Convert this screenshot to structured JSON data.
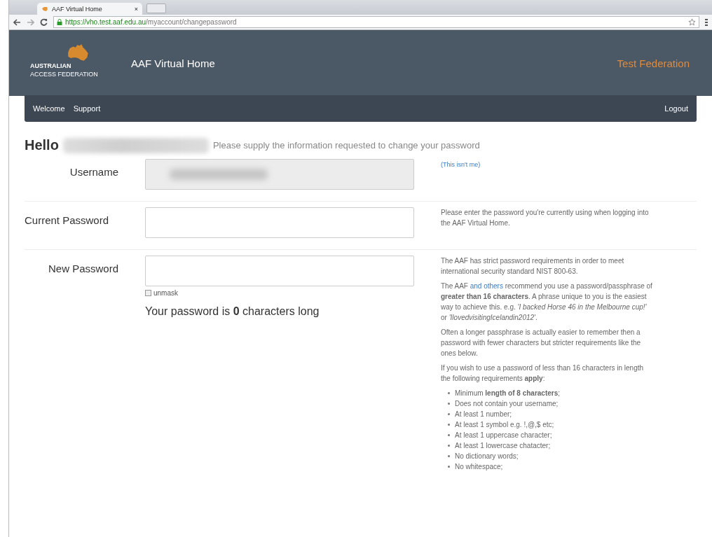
{
  "browser": {
    "tab_title": "AAF Virtual Home",
    "tab_close": "×",
    "url_host": "https://vho.test.aaf.edu.au",
    "url_path": "/myaccount/changepassword"
  },
  "header": {
    "logo_line1": "AUSTRALIAN",
    "logo_line2": "ACCESS FEDERATION",
    "title": "AAF Virtual Home",
    "federation": "Test Federation"
  },
  "nav": {
    "items": [
      "Welcome",
      "Support"
    ],
    "logout": "Logout"
  },
  "greeting": {
    "hello": "Hello",
    "subtitle": "Please supply the information requested to change your password"
  },
  "rows": [
    {
      "kind": "readonly",
      "label": "Username",
      "help": [
        {
          "kind": "link",
          "text": "(This isn't me)"
        }
      ]
    },
    {
      "kind": "password",
      "label": "Current Password",
      "help": [
        {
          "kind": "para",
          "parts": [
            {
              "text": "Please enter the password you're currently using when logging into the AAF Virtual Home."
            }
          ]
        }
      ]
    },
    {
      "kind": "newpassword",
      "label": "New Password",
      "unmask": {
        "label": "unmask",
        "checked": false
      },
      "length_text": "Your password is **0** characters long",
      "help": [
        {
          "kind": "para",
          "parts": [
            {
              "text": "The AAF has strict password requirements in order to meet international security standard NIST 800-63."
            }
          ]
        },
        {
          "kind": "para",
          "parts": [
            {
              "text": "The AAF "
            },
            {
              "link": "and others"
            },
            {
              "text": " recommend you use a password/passphrase of **greater than 16 characters**. A phrase unique to you is the easiest way to achieve this. e.g. *'I backed Horse 46 in the Melbourne cup!'* or *'IlovedvisitingIcelandin2012'*."
            }
          ]
        },
        {
          "kind": "para",
          "parts": [
            {
              "text": "Often a longer passphrase is actually easier to remember then a password with fewer characters but stricter requirements like the ones below."
            }
          ]
        },
        {
          "kind": "para",
          "parts": [
            {
              "text": "If you wish to use a password of less than 16 characters in length the following requirements **apply**:"
            }
          ]
        },
        {
          "kind": "list",
          "items": [
            "Minimum **length of 8 characters**;",
            "Does not contain your username;",
            "At least 1 number;",
            "At least 1 symbol e.g. !,@,$ etc;",
            "At least 1 uppercase character;",
            "At least 1 lowercase chatacter;",
            "No dictionary words;",
            "No whitespace;"
          ]
        }
      ]
    }
  ]
}
